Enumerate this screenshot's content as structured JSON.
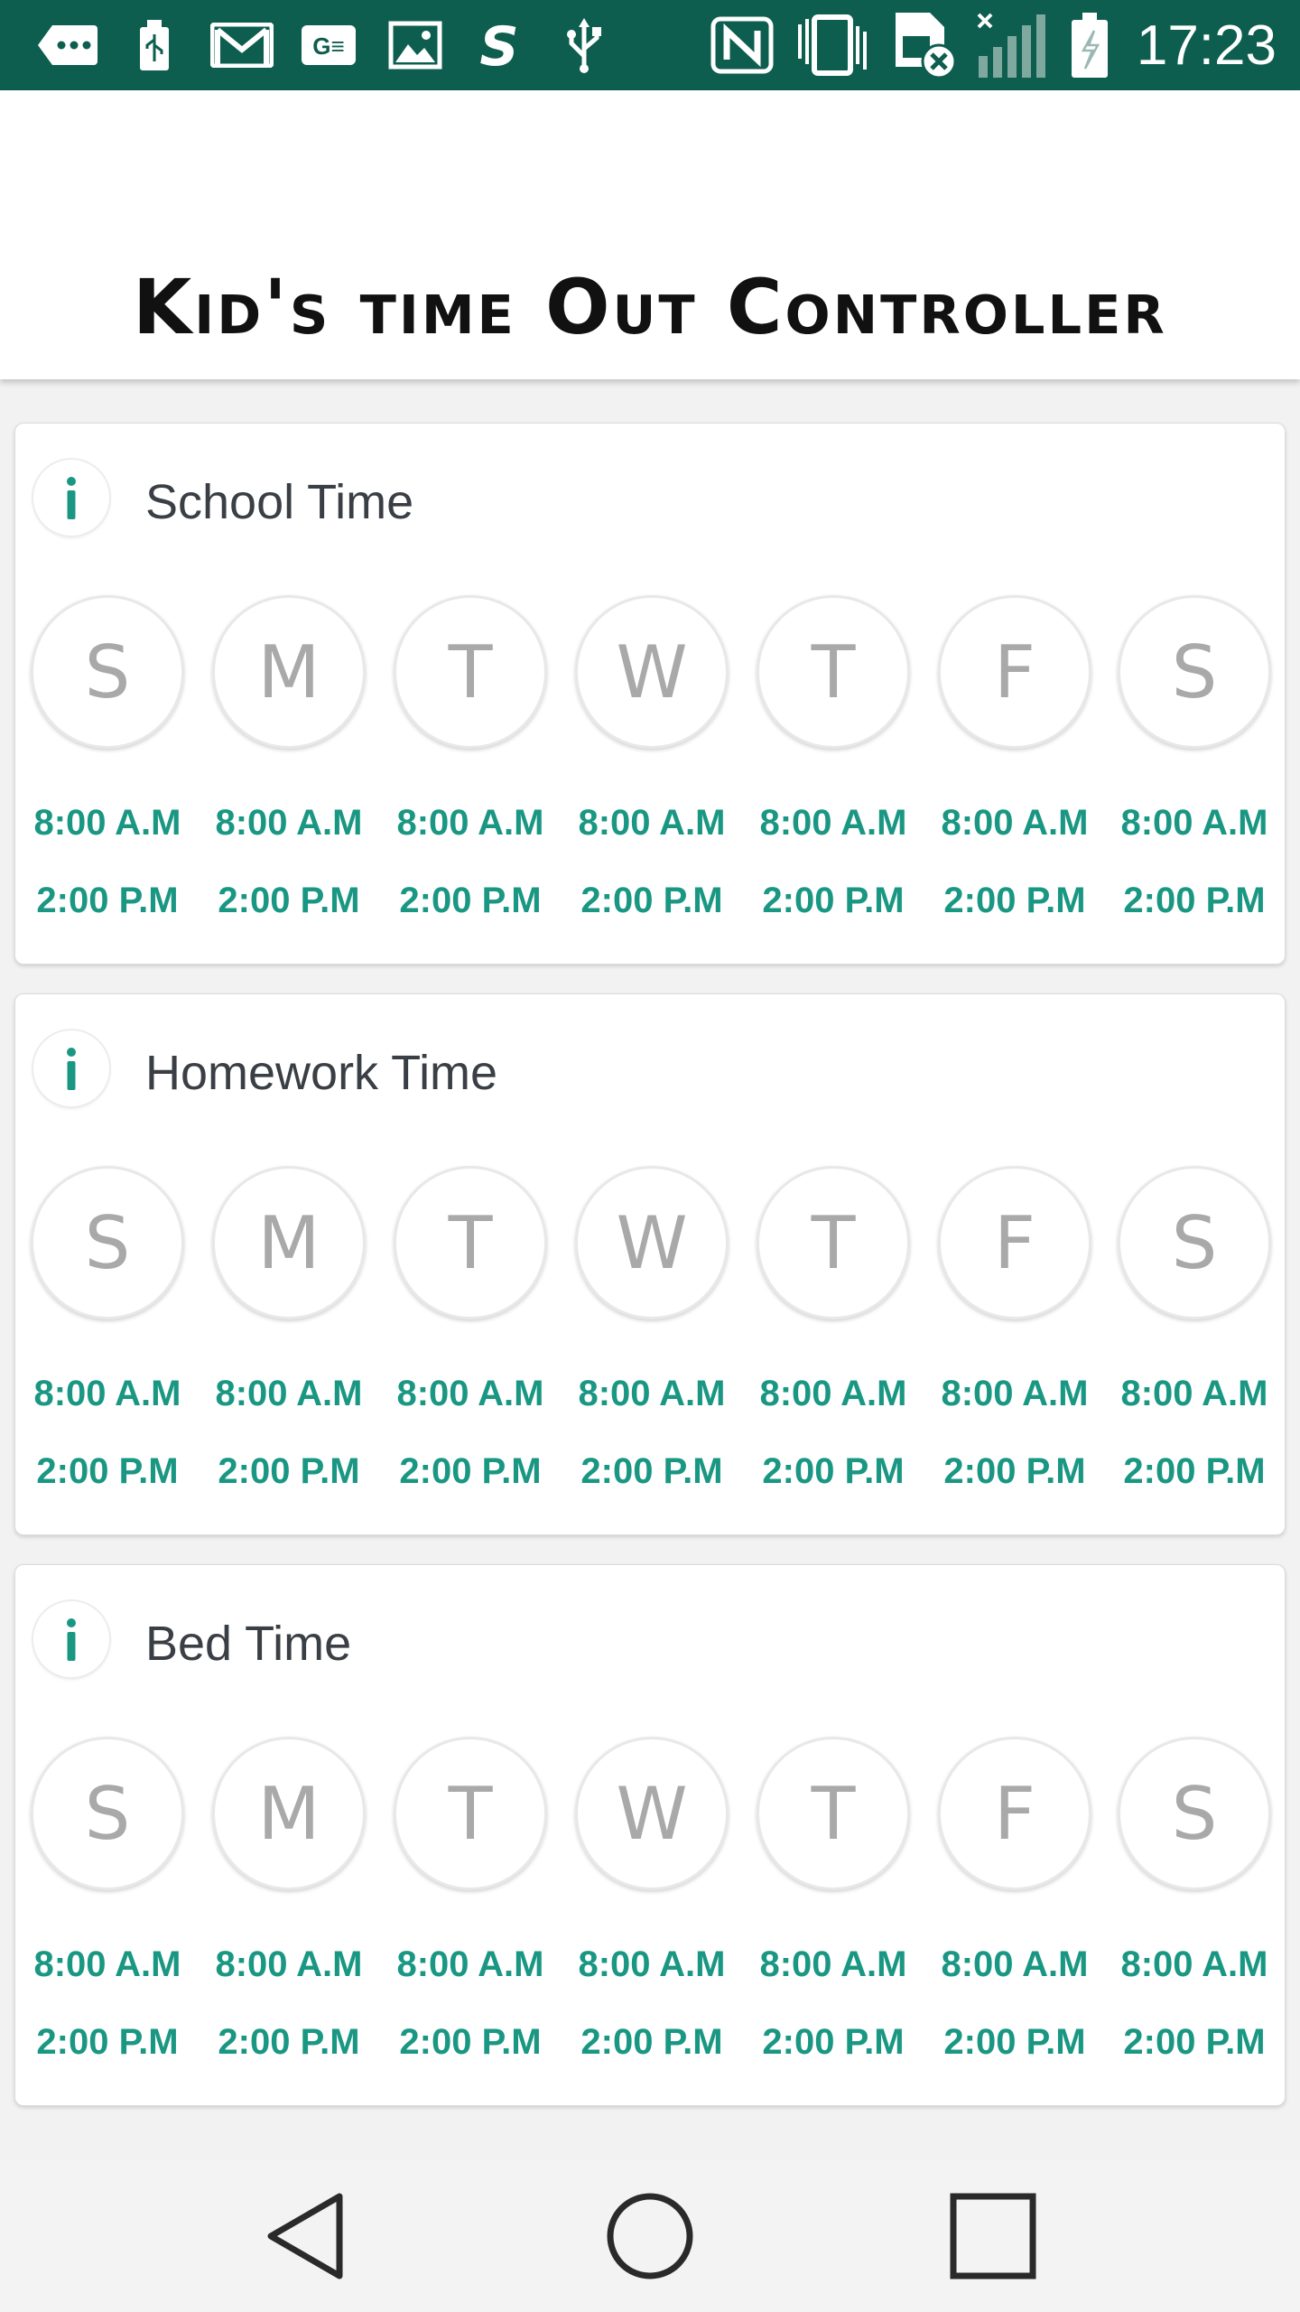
{
  "status_bar": {
    "time": "17:23",
    "icons_left": [
      "more-notifications-icon",
      "usb-icon",
      "gmail-icon",
      "ge-app-icon",
      "gallery-icon",
      "s-app-icon",
      "usb-debug-icon"
    ],
    "icons_right": [
      "nfc-icon",
      "vibrate-icon",
      "sim-missing-icon",
      "signal-icon",
      "battery-icon"
    ]
  },
  "header": {
    "title": "Kid's time Out Controller"
  },
  "cards": [
    {
      "title": "School Time",
      "days": [
        {
          "letter": "S",
          "start": "8:00 A.M",
          "end": "2:00 P.M"
        },
        {
          "letter": "M",
          "start": "8:00 A.M",
          "end": "2:00 P.M"
        },
        {
          "letter": "T",
          "start": "8:00 A.M",
          "end": "2:00 P.M"
        },
        {
          "letter": "W",
          "start": "8:00 A.M",
          "end": "2:00 P.M"
        },
        {
          "letter": "T",
          "start": "8:00 A.M",
          "end": "2:00 P.M"
        },
        {
          "letter": "F",
          "start": "8:00 A.M",
          "end": "2:00 P.M"
        },
        {
          "letter": "S",
          "start": "8:00 A.M",
          "end": "2:00 P.M"
        }
      ]
    },
    {
      "title": "Homework Time",
      "days": [
        {
          "letter": "S",
          "start": "8:00 A.M",
          "end": "2:00 P.M"
        },
        {
          "letter": "M",
          "start": "8:00 A.M",
          "end": "2:00 P.M"
        },
        {
          "letter": "T",
          "start": "8:00 A.M",
          "end": "2:00 P.M"
        },
        {
          "letter": "W",
          "start": "8:00 A.M",
          "end": "2:00 P.M"
        },
        {
          "letter": "T",
          "start": "8:00 A.M",
          "end": "2:00 P.M"
        },
        {
          "letter": "F",
          "start": "8:00 A.M",
          "end": "2:00 P.M"
        },
        {
          "letter": "S",
          "start": "8:00 A.M",
          "end": "2:00 P.M"
        }
      ]
    },
    {
      "title": "Bed Time",
      "days": [
        {
          "letter": "S",
          "start": "8:00 A.M",
          "end": "2:00 P.M"
        },
        {
          "letter": "M",
          "start": "8:00 A.M",
          "end": "2:00 P.M"
        },
        {
          "letter": "T",
          "start": "8:00 A.M",
          "end": "2:00 P.M"
        },
        {
          "letter": "W",
          "start": "8:00 A.M",
          "end": "2:00 P.M"
        },
        {
          "letter": "T",
          "start": "8:00 A.M",
          "end": "2:00 P.M"
        },
        {
          "letter": "F",
          "start": "8:00 A.M",
          "end": "2:00 P.M"
        },
        {
          "letter": "S",
          "start": "8:00 A.M",
          "end": "2:00 P.M"
        }
      ]
    }
  ],
  "nav_bar": {
    "buttons": [
      "back-icon",
      "home-icon",
      "recents-icon"
    ]
  },
  "colors": {
    "status_bar": "#0d5e4f",
    "accent": "#1a9783",
    "day_letter": "#a9a9a9",
    "card_title": "#3a3f45"
  }
}
